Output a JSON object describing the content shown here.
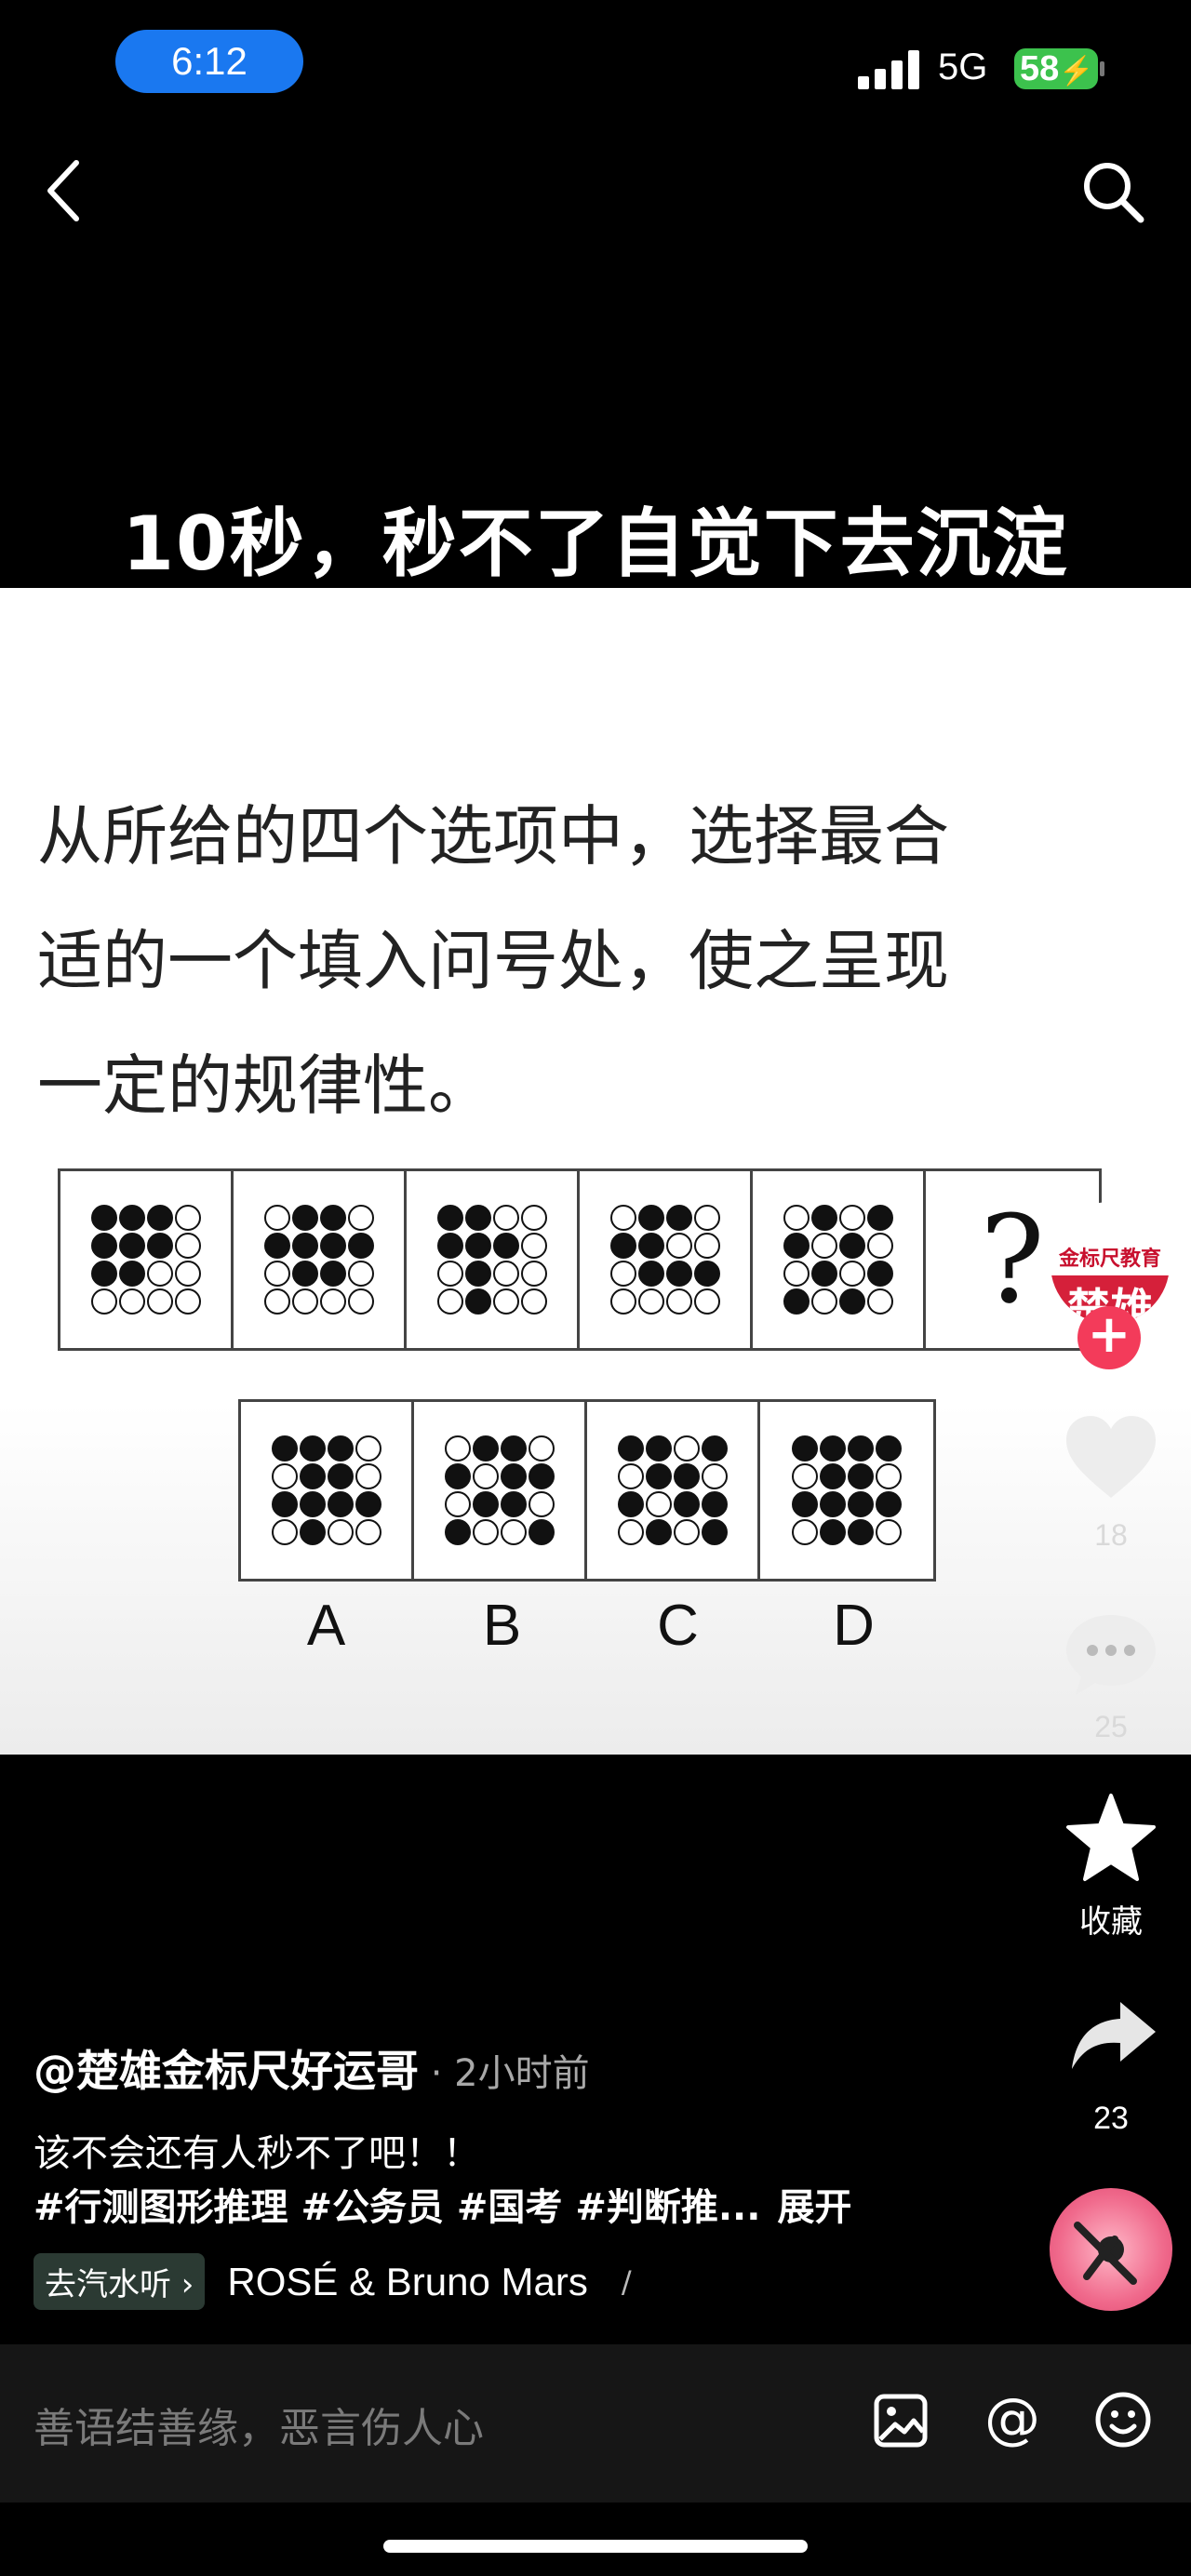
{
  "status_bar": {
    "time": "6:12",
    "network": "5G",
    "battery": "58"
  },
  "headline": "10秒，秒不了自觉下去沉淀",
  "question": {
    "lines": [
      "从所给的四个选项中，选择最合",
      "适的一个填入问号处，使之呈现",
      "一定的规律性。"
    ],
    "sequence": [
      [
        1,
        1,
        1,
        0,
        1,
        1,
        1,
        0,
        1,
        1,
        0,
        0,
        0,
        0,
        0,
        0
      ],
      [
        0,
        1,
        1,
        0,
        1,
        1,
        1,
        1,
        0,
        1,
        1,
        0,
        0,
        0,
        0,
        0
      ],
      [
        1,
        1,
        0,
        0,
        1,
        1,
        1,
        0,
        0,
        1,
        0,
        0,
        0,
        1,
        0,
        0
      ],
      [
        0,
        1,
        1,
        0,
        1,
        1,
        0,
        0,
        0,
        1,
        1,
        1,
        0,
        0,
        0,
        0
      ],
      [
        0,
        1,
        0,
        1,
        1,
        0,
        1,
        0,
        0,
        1,
        0,
        1,
        1,
        0,
        1,
        0
      ]
    ],
    "question_mark": "?",
    "options": [
      {
        "label": "A",
        "cells": [
          1,
          1,
          1,
          0,
          0,
          1,
          1,
          0,
          1,
          1,
          1,
          1,
          0,
          1,
          0,
          0
        ]
      },
      {
        "label": "B",
        "cells": [
          0,
          1,
          1,
          0,
          1,
          0,
          1,
          1,
          0,
          1,
          1,
          0,
          1,
          0,
          0,
          1
        ]
      },
      {
        "label": "C",
        "cells": [
          1,
          1,
          0,
          1,
          0,
          1,
          1,
          0,
          1,
          0,
          1,
          1,
          0,
          1,
          0,
          1
        ]
      },
      {
        "label": "D",
        "cells": [
          1,
          1,
          1,
          1,
          0,
          1,
          1,
          0,
          1,
          1,
          1,
          1,
          0,
          1,
          1,
          0
        ]
      }
    ]
  },
  "actions": {
    "avatar_top": "金标尺教育",
    "avatar_bottom": "楚雄",
    "follow": "+",
    "likes": "18",
    "comments": "25",
    "favorite_label": "收藏",
    "shares": "23"
  },
  "post": {
    "author": "@楚雄金标尺好运哥",
    "time": " · 2小时前",
    "caption": "该不会还有人秒不了吧！！",
    "tags": "#行测图形推理 #公务员 #国考 #判断推...",
    "expand": "展开",
    "listen_label": "去汽水听 ›",
    "song": "ROSÉ & Bruno Mars",
    "song_sep": "/"
  },
  "comment_bar": {
    "placeholder": "善语结善缘，恶言伤人心",
    "at_symbol": "@"
  },
  "colors": {
    "accent_blue": "#1a78f0",
    "battery_green": "#3cc24d",
    "follow_red": "#f33b5a"
  }
}
